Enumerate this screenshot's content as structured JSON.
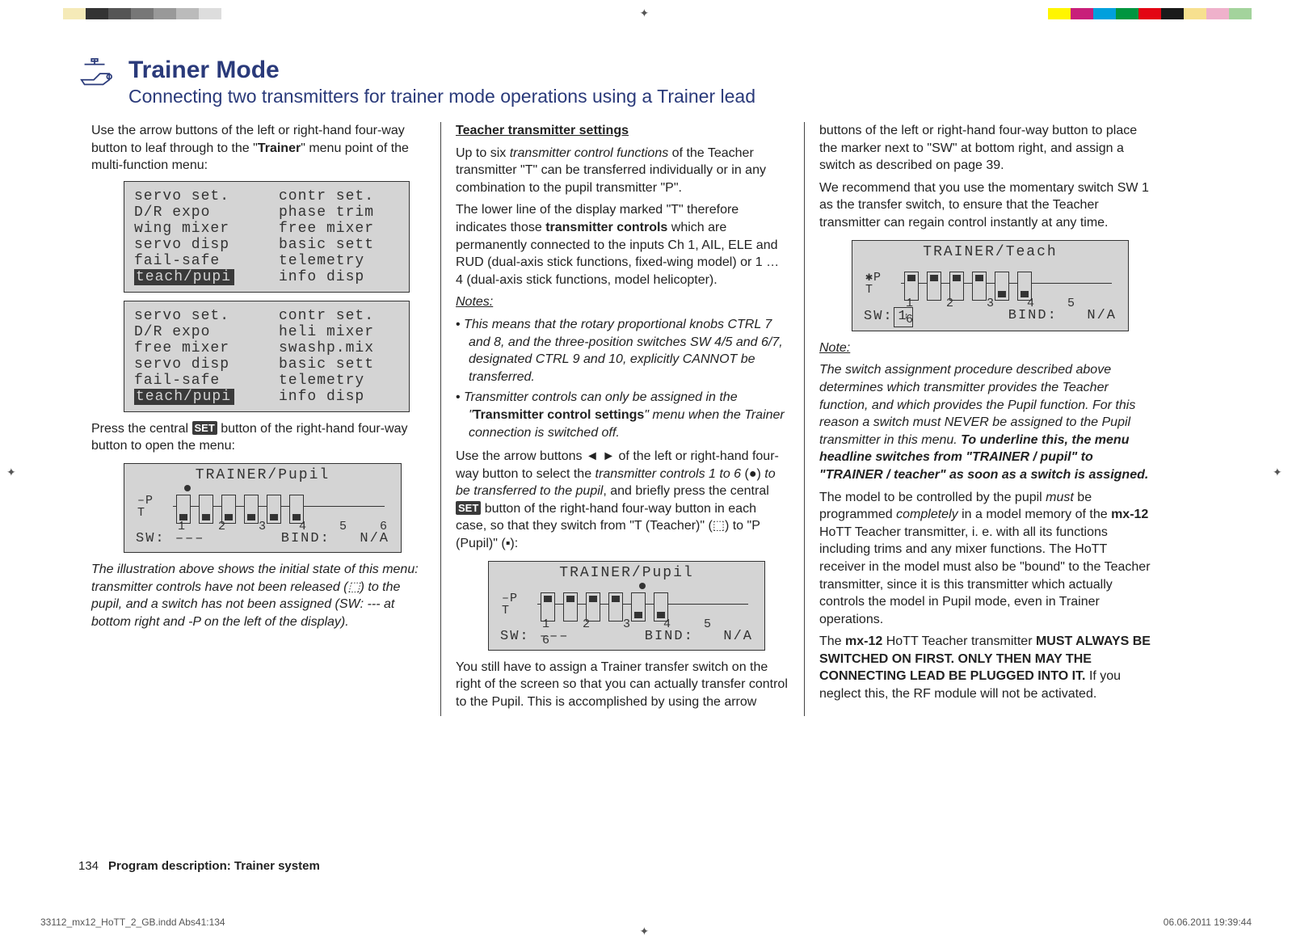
{
  "colors_left": [
    "#fff",
    "#f5eab8",
    "#333",
    "#555",
    "#777",
    "#999",
    "#bbb",
    "#ddd",
    "#fff"
  ],
  "colors_right": [
    "#fff500",
    "#c81f7a",
    "#00a0dd",
    "#009640",
    "#e30613",
    "#1a1a1a",
    "#f7e08f",
    "#efb1cb",
    "#a3d39c"
  ],
  "header": {
    "title": "Trainer Mode",
    "subtitle": "Connecting two transmitters for trainer mode operations using a Trainer lead"
  },
  "col1": {
    "intro_a": "Use the arrow buttons of the left or right-hand four-way button to leaf through to the \"",
    "intro_b": "Trainer",
    "intro_c": "\" menu point of the multi-function menu:",
    "menu1_left": [
      "servo set.",
      "D/R expo",
      "wing mixer",
      "servo disp",
      "fail-safe",
      "teach/pupi"
    ],
    "menu1_right": [
      "contr set.",
      "phase trim",
      "free mixer",
      "basic sett",
      "telemetry",
      "info disp"
    ],
    "menu2_left": [
      "servo set.",
      "D/R expo",
      "free mixer",
      "servo disp",
      "fail-safe",
      "teach/pupi"
    ],
    "menu2_right": [
      "contr set.",
      "heli mixer",
      "swashp.mix",
      "basic sett",
      "telemetry",
      "info disp"
    ],
    "press_a": "Press the central ",
    "press_set": "SET",
    "press_b": " button of the right-hand four-way button to open the menu:",
    "lcd1": {
      "title": "TRAINER/Pupil",
      "left_top": "–P",
      "left_bot": "T",
      "nums": "123456",
      "sw_label": "SW:",
      "sw_val": "–––",
      "bind_label": "BIND:",
      "bind_val": "N/A"
    },
    "note": "The illustration above shows the initial state of this menu: transmitter controls have not been released (⬚) to the pupil, and a switch has not been assigned (SW: --- at bottom right and -P on the left of the display)."
  },
  "col2": {
    "h": "Teacher transmitter settings",
    "p1a": "Up to six ",
    "p1b": "transmitter control functions",
    "p1c": " of the Teacher transmitter \"T\" can be transferred individually or in any combination to the pupil transmitter \"P\".",
    "p2a": "The lower line of the display marked \"T\" therefore indicates those ",
    "p2b": "transmitter controls",
    "p2c": " which are permanently connected to the inputs Ch 1, AIL, ELE and RUD (dual-axis stick functions, fixed-wing model) or 1 … 4 (dual-axis stick functions, model helicopter).",
    "notes_h": "Notes:",
    "li1": "This means that the rotary proportional knobs CTRL 7 and 8, and the three-position switches SW 4/5 and 6/7, designated CTRL 9 and 10, explicitly CANNOT be transferred.",
    "li2a": "Transmitter controls can only be assigned in the \"",
    "li2b": "Transmitter control settings",
    "li2c": "\" menu when the Trainer connection is switched off.",
    "p3a": "Use the arrow buttons ◄ ► of the left or right-hand four-way button to select the ",
    "p3b": "transmitter controls 1 to 6",
    "p3c": " (●) ",
    "p3d": "to be transferred to the pupil",
    "p3e": ", and briefly press the central ",
    "p3set": "SET",
    "p3f": " button of the right-hand four-way button in each case, so that they switch from \"T (Teacher)\" (⬚) to \"P (Pupil)\" (▪):",
    "lcd2": {
      "title": "TRAINER/Pupil",
      "left_top": "–P",
      "left_bot": "T",
      "nums": "123456",
      "sw_label": "SW:",
      "sw_val": "–––",
      "bind_label": "BIND:",
      "bind_val": "N/A"
    },
    "p4": "You still have to assign a Trainer transfer switch on the right of the screen so that you can actually transfer control to the Pupil. This is accomplished by using the arrow"
  },
  "col3": {
    "p0": "buttons of the left or right-hand four-way button to place the marker next to \"SW\" at bottom right, and assign a switch as described on page 39.",
    "p1": "We recommend that you use the momentary switch SW 1 as the transfer switch, to ensure that the Teacher transmitter can regain control instantly at any time.",
    "lcd3": {
      "title": "TRAINER/Teach",
      "left_top": "✱P",
      "left_bot": "T",
      "nums": "123456",
      "sw_label": "SW:",
      "sw_val": "1",
      "bind_label": "BIND:",
      "bind_val": "N/A"
    },
    "note_h": "Note:",
    "note_a": "The switch assignment procedure described above determines which transmitter provides the Teacher function, and which provides the Pupil function. For this reason a switch must NEVER be assigned to the Pupil transmitter in this menu. ",
    "note_b": "To underline this, the menu headline switches from \"TRAINER / pupil\" to \"TRAINER / teacher\" as soon as a switch is assigned.",
    "p2a": "The model to be controlled by the pupil ",
    "p2b": "must",
    "p2c": " be programmed ",
    "p2d": "completely",
    "p2e": " in a model memory of the ",
    "p2f": "mx-12",
    "p2g": " HoTT Teacher transmitter, i. e. with all its functions including trims and any mixer functions. The HoTT receiver in the model must also be \"bound\" to the Teacher transmitter, since it is this transmitter which actually controls the model in Pupil mode, even in Trainer operations.",
    "p3a": "The ",
    "p3b": "mx-12",
    "p3c": " HoTT Teacher transmitter ",
    "p3d": "MUST ALWAYS BE SWITCHED ON FIRST. ONLY THEN MAY THE CONNECTING LEAD BE PLUGGED INTO IT.",
    "p3e": " If you neglect this, the RF module will not be activated."
  },
  "footer": {
    "pageno": "134",
    "desc": "Program description: Trainer system"
  },
  "imposition": {
    "left": "33112_mx12_HoTT_2_GB.indd   Abs41:134",
    "right": "06.06.2011   19:39:44"
  }
}
